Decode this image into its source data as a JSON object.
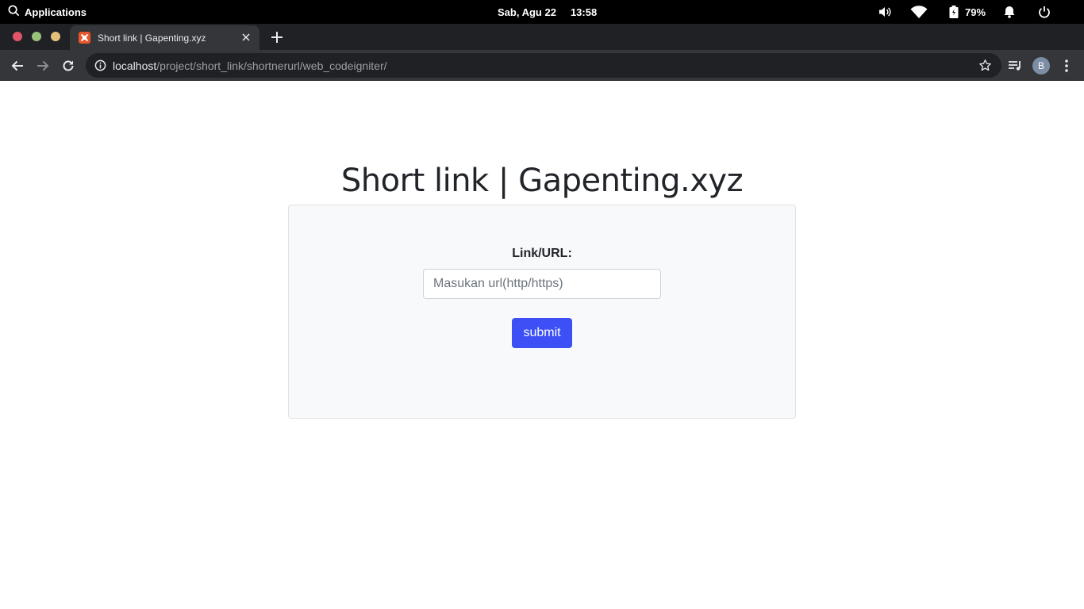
{
  "system_bar": {
    "apps_label": "Applications",
    "date": "Sab, Agu 22",
    "time": "13:58",
    "battery_percent": "79%",
    "icons": [
      "search-icon",
      "volume-icon",
      "wifi-icon",
      "battery-icon",
      "bell-icon",
      "power-icon"
    ]
  },
  "browser": {
    "tab": {
      "title": "Short link | Gapenting.xyz",
      "favicon": "xampp-icon"
    },
    "address": {
      "host": "localhost",
      "path": "/project/short_link/shortnerurl/web_codeigniter/"
    },
    "profile_initial": "B",
    "colors": {
      "frame": "#202124",
      "toolbar": "#35363a",
      "window_close": "#e0556a",
      "window_min": "#98c379",
      "window_max": "#e5c07b"
    }
  },
  "page": {
    "heading": "Short link | Gapenting.xyz",
    "form": {
      "label": "Link/URL:",
      "input_value": "",
      "input_placeholder": "Masukan url(http/https)",
      "submit_label": "submit"
    },
    "colors": {
      "button": "#3d50f5",
      "card_bg": "#f8f9fa",
      "text": "#212529"
    }
  }
}
